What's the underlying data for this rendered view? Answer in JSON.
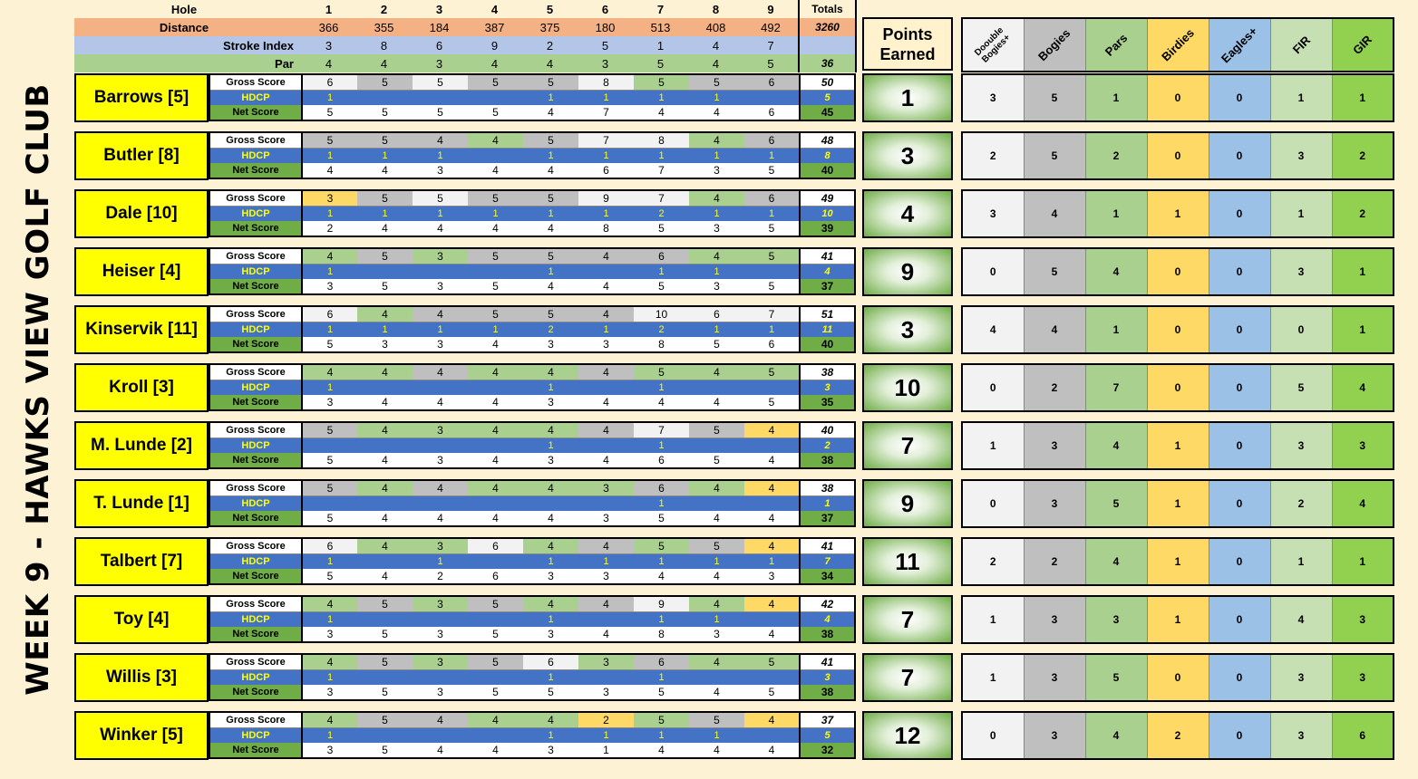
{
  "title": "WEEK 9 - HAWKS VIEW GOLF CLUB",
  "header": {
    "hole_label": "Hole",
    "holes": [
      "1",
      "2",
      "3",
      "4",
      "5",
      "6",
      "7",
      "8",
      "9"
    ],
    "totals_label": "Totals",
    "distance_label": "Distance",
    "distance": [
      "366",
      "355",
      "184",
      "387",
      "375",
      "180",
      "513",
      "408",
      "492"
    ],
    "distance_total": "3260",
    "si_label": "Stroke Index",
    "stroke_index": [
      "3",
      "8",
      "6",
      "9",
      "2",
      "5",
      "1",
      "4",
      "7"
    ],
    "par_label": "Par",
    "par": [
      "4",
      "4",
      "3",
      "4",
      "4",
      "3",
      "5",
      "4",
      "5"
    ],
    "par_total": "36"
  },
  "points_header": "Points Earned",
  "stats_headers": [
    "Doouble Bogies+",
    "Bogies",
    "Pars",
    "Birdies",
    "Eagles+",
    "FIR",
    "GIR"
  ],
  "row_labels": {
    "gross": "Gross Score",
    "hdcp": "HDCP",
    "net": "Net Score"
  },
  "colors": {
    "double_bogey": "#f2f2f2",
    "bogey": "#bfbfbf",
    "par": "#a9d08e",
    "birdie": "#ffd966",
    "eagle": "#9bc2e6",
    "fir": "#c6e0b4",
    "gir": "#92d050",
    "hdcp_row": "#4472c4",
    "name_bg": "#ffff00"
  },
  "players": [
    {
      "name": "Barrows [5]",
      "gross": [
        "6",
        "5",
        "5",
        "5",
        "5",
        "8",
        "5",
        "5",
        "6"
      ],
      "gross_total": "50",
      "hdcp": [
        "1",
        "",
        "",
        "",
        "1",
        "1",
        "1",
        "1",
        ""
      ],
      "hdcp_total": "5",
      "net": [
        "5",
        "5",
        "5",
        "5",
        "4",
        "7",
        "4",
        "4",
        "6"
      ],
      "net_total": "45",
      "points": "1",
      "stats": [
        "3",
        "5",
        "1",
        "0",
        "0",
        "1",
        "1"
      ]
    },
    {
      "name": "Butler [8]",
      "gross": [
        "5",
        "5",
        "4",
        "4",
        "5",
        "7",
        "8",
        "4",
        "6"
      ],
      "gross_total": "48",
      "hdcp": [
        "1",
        "1",
        "1",
        "",
        "1",
        "1",
        "1",
        "1",
        "1"
      ],
      "hdcp_total": "8",
      "net": [
        "4",
        "4",
        "3",
        "4",
        "4",
        "6",
        "7",
        "3",
        "5"
      ],
      "net_total": "40",
      "points": "3",
      "stats": [
        "2",
        "5",
        "2",
        "0",
        "0",
        "3",
        "2"
      ]
    },
    {
      "name": "Dale [10]",
      "gross": [
        "3",
        "5",
        "5",
        "5",
        "5",
        "9",
        "7",
        "4",
        "6"
      ],
      "gross_total": "49",
      "hdcp": [
        "1",
        "1",
        "1",
        "1",
        "1",
        "1",
        "2",
        "1",
        "1"
      ],
      "hdcp_total": "10",
      "net": [
        "2",
        "4",
        "4",
        "4",
        "4",
        "8",
        "5",
        "3",
        "5"
      ],
      "net_total": "39",
      "points": "4",
      "stats": [
        "3",
        "4",
        "1",
        "1",
        "0",
        "1",
        "2"
      ]
    },
    {
      "name": "Heiser [4]",
      "gross": [
        "4",
        "5",
        "3",
        "5",
        "5",
        "4",
        "6",
        "4",
        "5"
      ],
      "gross_total": "41",
      "hdcp": [
        "1",
        "",
        "",
        "",
        "1",
        "",
        "1",
        "1",
        ""
      ],
      "hdcp_total": "4",
      "net": [
        "3",
        "5",
        "3",
        "5",
        "4",
        "4",
        "5",
        "3",
        "5"
      ],
      "net_total": "37",
      "points": "9",
      "stats": [
        "0",
        "5",
        "4",
        "0",
        "0",
        "3",
        "1"
      ]
    },
    {
      "name": "Kinservik [11]",
      "gross": [
        "6",
        "4",
        "4",
        "5",
        "5",
        "4",
        "10",
        "6",
        "7"
      ],
      "gross_total": "51",
      "hdcp": [
        "1",
        "1",
        "1",
        "1",
        "2",
        "1",
        "2",
        "1",
        "1"
      ],
      "hdcp_total": "11",
      "net": [
        "5",
        "3",
        "3",
        "4",
        "3",
        "3",
        "8",
        "5",
        "6"
      ],
      "net_total": "40",
      "points": "3",
      "stats": [
        "4",
        "4",
        "1",
        "0",
        "0",
        "0",
        "1"
      ]
    },
    {
      "name": "Kroll [3]",
      "gross": [
        "4",
        "4",
        "4",
        "4",
        "4",
        "4",
        "5",
        "4",
        "5"
      ],
      "gross_total": "38",
      "hdcp": [
        "1",
        "",
        "",
        "",
        "1",
        "",
        "1",
        "",
        ""
      ],
      "hdcp_total": "3",
      "net": [
        "3",
        "4",
        "4",
        "4",
        "3",
        "4",
        "4",
        "4",
        "5"
      ],
      "net_total": "35",
      "points": "10",
      "stats": [
        "0",
        "2",
        "7",
        "0",
        "0",
        "5",
        "4"
      ]
    },
    {
      "name": "M. Lunde [2]",
      "gross": [
        "5",
        "4",
        "3",
        "4",
        "4",
        "4",
        "7",
        "5",
        "4"
      ],
      "gross_total": "40",
      "hdcp": [
        "",
        "",
        "",
        "",
        "1",
        "",
        "1",
        "",
        ""
      ],
      "hdcp_total": "2",
      "net": [
        "5",
        "4",
        "3",
        "4",
        "3",
        "4",
        "6",
        "5",
        "4"
      ],
      "net_total": "38",
      "points": "7",
      "stats": [
        "1",
        "3",
        "4",
        "1",
        "0",
        "3",
        "3"
      ]
    },
    {
      "name": "T. Lunde [1]",
      "gross": [
        "5",
        "4",
        "4",
        "4",
        "4",
        "3",
        "6",
        "4",
        "4"
      ],
      "gross_total": "38",
      "hdcp": [
        "",
        "",
        "",
        "",
        "",
        "",
        "1",
        "",
        ""
      ],
      "hdcp_total": "1",
      "net": [
        "5",
        "4",
        "4",
        "4",
        "4",
        "3",
        "5",
        "4",
        "4"
      ],
      "net_total": "37",
      "points": "9",
      "stats": [
        "0",
        "3",
        "5",
        "1",
        "0",
        "2",
        "4"
      ]
    },
    {
      "name": "Talbert [7]",
      "gross": [
        "6",
        "4",
        "3",
        "6",
        "4",
        "4",
        "5",
        "5",
        "4"
      ],
      "gross_total": "41",
      "hdcp": [
        "1",
        "",
        "1",
        "",
        "1",
        "1",
        "1",
        "1",
        "1"
      ],
      "hdcp_total": "7",
      "net": [
        "5",
        "4",
        "2",
        "6",
        "3",
        "3",
        "4",
        "4",
        "3"
      ],
      "net_total": "34",
      "points": "11",
      "stats": [
        "2",
        "2",
        "4",
        "1",
        "0",
        "1",
        "1"
      ]
    },
    {
      "name": "Toy [4]",
      "gross": [
        "4",
        "5",
        "3",
        "5",
        "4",
        "4",
        "9",
        "4",
        "4"
      ],
      "gross_total": "42",
      "hdcp": [
        "1",
        "",
        "",
        "",
        "1",
        "",
        "1",
        "1",
        ""
      ],
      "hdcp_total": "4",
      "net": [
        "3",
        "5",
        "3",
        "5",
        "3",
        "4",
        "8",
        "3",
        "4"
      ],
      "net_total": "38",
      "points": "7",
      "stats": [
        "1",
        "3",
        "3",
        "1",
        "0",
        "4",
        "3"
      ]
    },
    {
      "name": "Willis [3]",
      "gross": [
        "4",
        "5",
        "3",
        "5",
        "6",
        "3",
        "6",
        "4",
        "5"
      ],
      "gross_total": "41",
      "hdcp": [
        "1",
        "",
        "",
        "",
        "1",
        "",
        "1",
        "",
        ""
      ],
      "hdcp_total": "3",
      "net": [
        "3",
        "5",
        "3",
        "5",
        "5",
        "3",
        "5",
        "4",
        "5"
      ],
      "net_total": "38",
      "points": "7",
      "stats": [
        "1",
        "3",
        "5",
        "0",
        "0",
        "3",
        "3"
      ]
    },
    {
      "name": "Winker [5]",
      "gross": [
        "4",
        "5",
        "4",
        "4",
        "4",
        "2",
        "5",
        "5",
        "4"
      ],
      "gross_total": "37",
      "hdcp": [
        "1",
        "",
        "",
        "",
        "1",
        "1",
        "1",
        "1",
        ""
      ],
      "hdcp_total": "5",
      "net": [
        "3",
        "5",
        "4",
        "4",
        "3",
        "1",
        "4",
        "4",
        "4"
      ],
      "net_total": "32",
      "points": "12",
      "stats": [
        "0",
        "3",
        "4",
        "2",
        "0",
        "3",
        "6"
      ]
    }
  ]
}
